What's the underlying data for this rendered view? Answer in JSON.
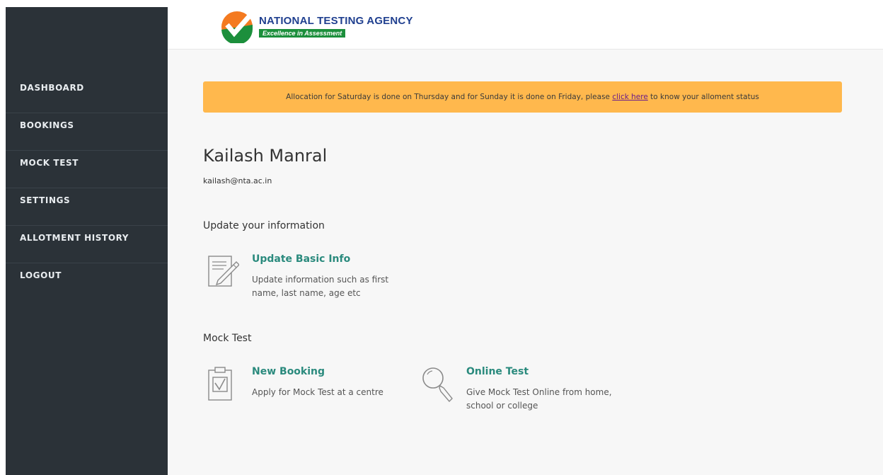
{
  "sidebar": {
    "items": [
      {
        "label": "DASHBOARD"
      },
      {
        "label": "BOOKINGS"
      },
      {
        "label": "MOCK TEST"
      },
      {
        "label": "SETTINGS"
      },
      {
        "label": "ALLOTMENT HISTORY"
      },
      {
        "label": "LOGOUT"
      }
    ]
  },
  "header": {
    "logo_title": "NATIONAL TESTING AGENCY",
    "logo_tagline": "Excellence in Assessment"
  },
  "banner": {
    "text_before": "Allocation for Saturday is done on Thursday and for Sunday it is done on Friday, please ",
    "link_text": "click here",
    "text_after": " to know your alloment status"
  },
  "user": {
    "name": "Kailash Manral",
    "email": "kailash@nta.ac.in"
  },
  "sections": {
    "update_info": {
      "title": "Update your information",
      "basic_info_title": "Update Basic Info",
      "basic_info_desc": "Update information such as first name, last name, age etc"
    },
    "mock_test": {
      "title": "Mock Test",
      "new_booking_title": "New Booking",
      "new_booking_desc": "Apply for Mock Test at a centre",
      "online_test_title": "Online Test",
      "online_test_desc": "Give Mock Test Online from home, school or college"
    }
  },
  "icons": {
    "logo": "nta-logo-icon",
    "edit": "edit-document-icon",
    "booking": "clipboard-check-icon",
    "online": "magnifier-icon"
  },
  "colors": {
    "sidebar": "#2b3238",
    "banner": "#ffb84d",
    "accent": "#2a8a7d",
    "logo_orange": "#f47a20",
    "logo_green": "#1c8f3c",
    "logo_blue": "#1f3f8f"
  }
}
